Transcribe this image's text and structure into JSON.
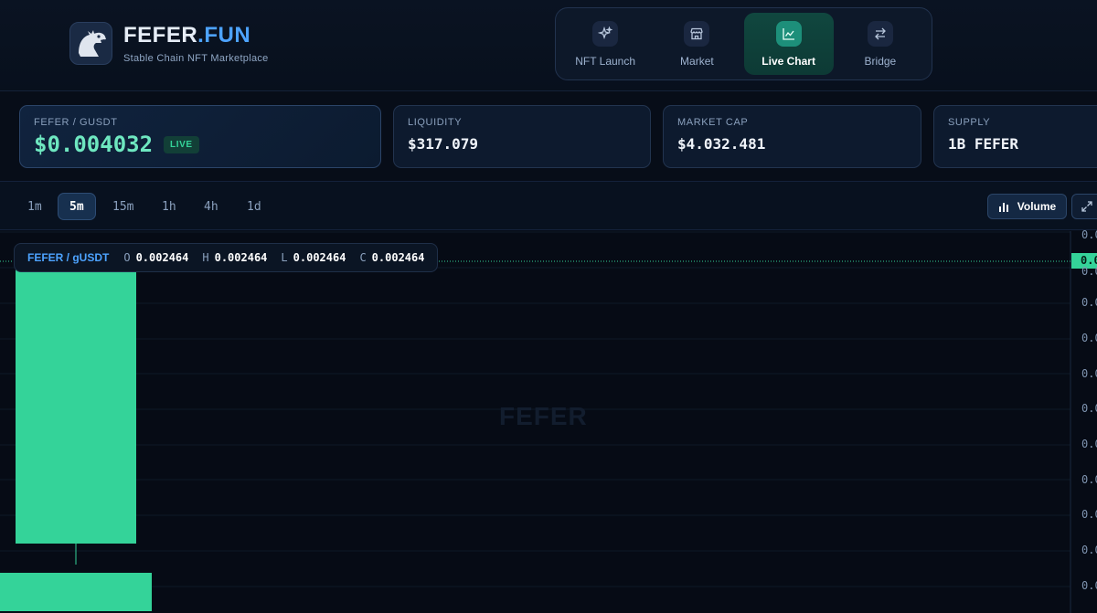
{
  "brand": {
    "name_main": "FEFER",
    "name_accent": ".FUN",
    "subtitle": "Stable Chain NFT Marketplace"
  },
  "nav": [
    {
      "label": "NFT Launch",
      "icon": "sparkles-icon",
      "active": false
    },
    {
      "label": "Market",
      "icon": "store-icon",
      "active": false
    },
    {
      "label": "Live Chart",
      "icon": "line-chart-icon",
      "active": true
    },
    {
      "label": "Bridge",
      "icon": "swap-arrows-icon",
      "active": false
    }
  ],
  "stats": {
    "pair_label": "FEFER / GUSDT",
    "price": "$0.004032",
    "live_badge": "LIVE",
    "liquidity_label": "LIQUIDITY",
    "liquidity": "$317.079",
    "marketcap_label": "MARKET CAP",
    "marketcap": "$4.032.481",
    "supply_label": "SUPPLY",
    "supply": "1B FEFER"
  },
  "timeframes": [
    {
      "label": "1m",
      "active": false
    },
    {
      "label": "5m",
      "active": true
    },
    {
      "label": "15m",
      "active": false
    },
    {
      "label": "1h",
      "active": false
    },
    {
      "label": "4h",
      "active": false
    },
    {
      "label": "1d",
      "active": false
    }
  ],
  "toolbar": {
    "volume_label": "Volume"
  },
  "ohlc": {
    "pair": "FEFER / gUSDT",
    "o_label": "O",
    "o": "0.002464",
    "h_label": "H",
    "h": "0.002464",
    "l_label": "L",
    "l": "0.002464",
    "c_label": "C",
    "c": "0.002464"
  },
  "chart": {
    "watermark": "FEFER",
    "last_price_tag": "0.0",
    "axis_labels": [
      "0.0",
      "0.0",
      "0.0",
      "0.0",
      "0.0",
      "0.0",
      "0.0",
      "0.0",
      "0.0",
      "0.0",
      "0.0"
    ]
  },
  "colors": {
    "up": "#34d399",
    "accent": "#4da3ff",
    "background": "#070d18"
  }
}
